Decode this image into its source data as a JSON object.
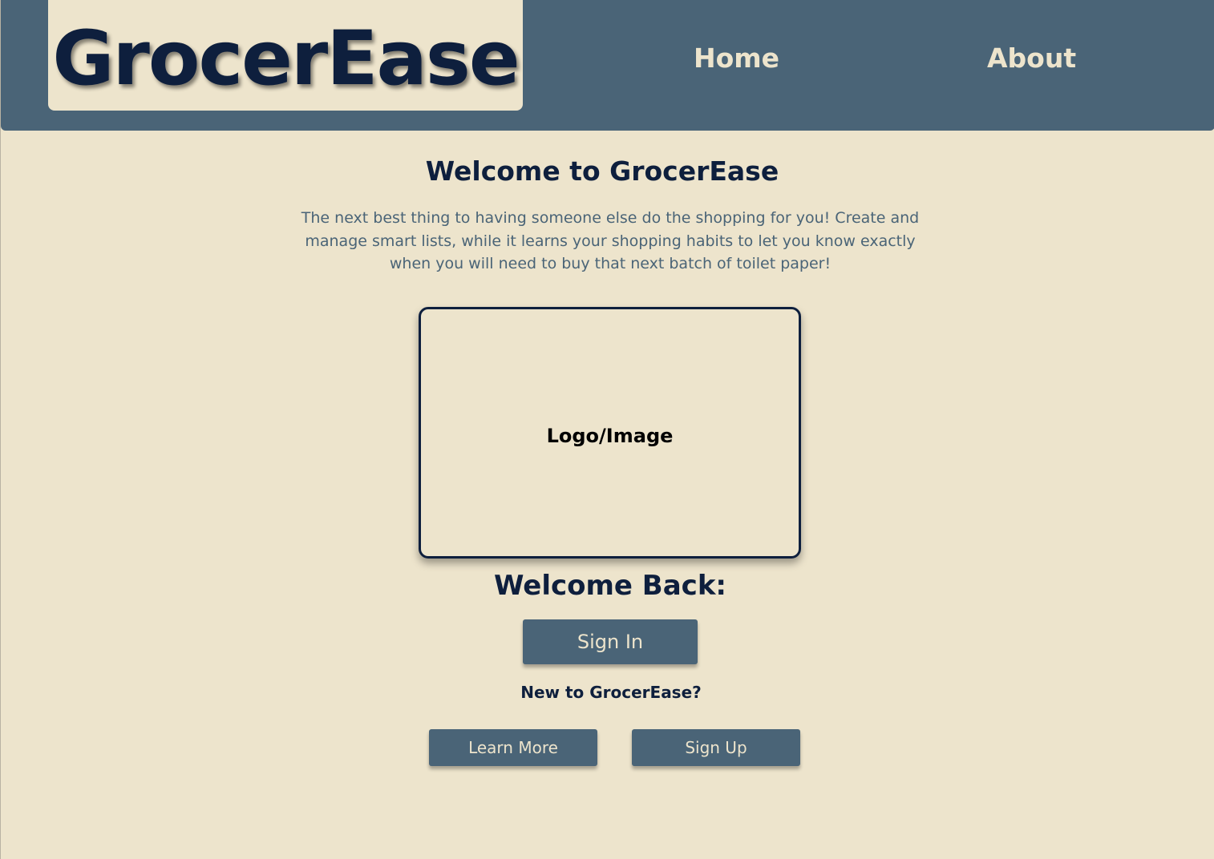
{
  "header": {
    "brand": "GrocerEase",
    "nav": {
      "home": "Home",
      "about": "About"
    }
  },
  "main": {
    "title": "Welcome to GrocerEase",
    "intro": "The next best thing to having someone else do the shopping for you! Create and manage smart lists, while it learns your shopping habits to let you know exactly when you will need to buy that next batch of toilet paper!",
    "logo_placeholder": "Logo/Image",
    "welcome_back": "Welcome Back:",
    "sign_in_label": "Sign In",
    "new_prompt": "New to GrocerEase?",
    "learn_more_label": "Learn More",
    "sign_up_label": "Sign Up"
  },
  "colors": {
    "background": "#ede4cc",
    "header": "#4a6477",
    "text_dark": "#0e1f3d",
    "button": "#4a6477"
  }
}
